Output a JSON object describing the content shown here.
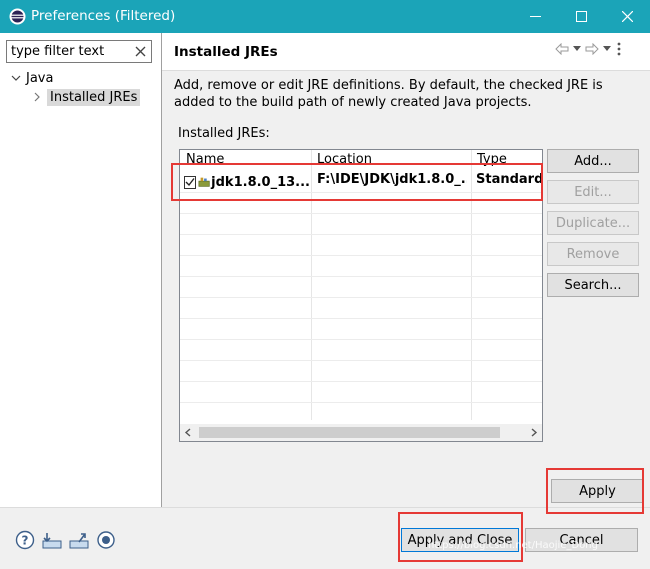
{
  "window": {
    "title": "Preferences (Filtered)",
    "controls": [
      "minimize-icon",
      "maximize-icon",
      "close-icon"
    ]
  },
  "filter": {
    "placeholder": "type filter text",
    "clear_icon": "clear-icon"
  },
  "tree": {
    "items": [
      {
        "label": "Java",
        "expanded": true
      },
      {
        "label": "Installed JREs",
        "expanded": false,
        "selected": true
      }
    ]
  },
  "page": {
    "title": "Installed JREs",
    "description": "Add, remove or edit JRE definitions. By default, the checked JRE is added to the build path of newly created Java projects.",
    "list_label": "Installed JREs:",
    "history_icons": [
      "back-arrow-icon",
      "back-dropdown-icon",
      "forward-arrow-icon",
      "forward-dropdown-icon",
      "view-menu-icon"
    ]
  },
  "table": {
    "columns": [
      "Name",
      "Location",
      "Type"
    ],
    "rows": [
      {
        "checked": true,
        "name": "jdk1.8.0_13...",
        "location": "F:\\IDE\\JDK\\jdk1.8.0_...",
        "type": "Standard"
      }
    ]
  },
  "buttons": {
    "add": "Add...",
    "edit": "Edit...",
    "duplicate": "Duplicate...",
    "remove": "Remove",
    "search": "Search...",
    "apply": "Apply",
    "apply_and_close": "Apply and Close",
    "cancel": "Cancel"
  },
  "bottom_icons": [
    "help-icon",
    "import-icon",
    "export-icon",
    "record-icon"
  ],
  "watermark": "https://blog.csdn.net/Haojie_Dong",
  "colors": {
    "titlebar": "#1ba4b8",
    "highlight_box": "#e53935"
  }
}
